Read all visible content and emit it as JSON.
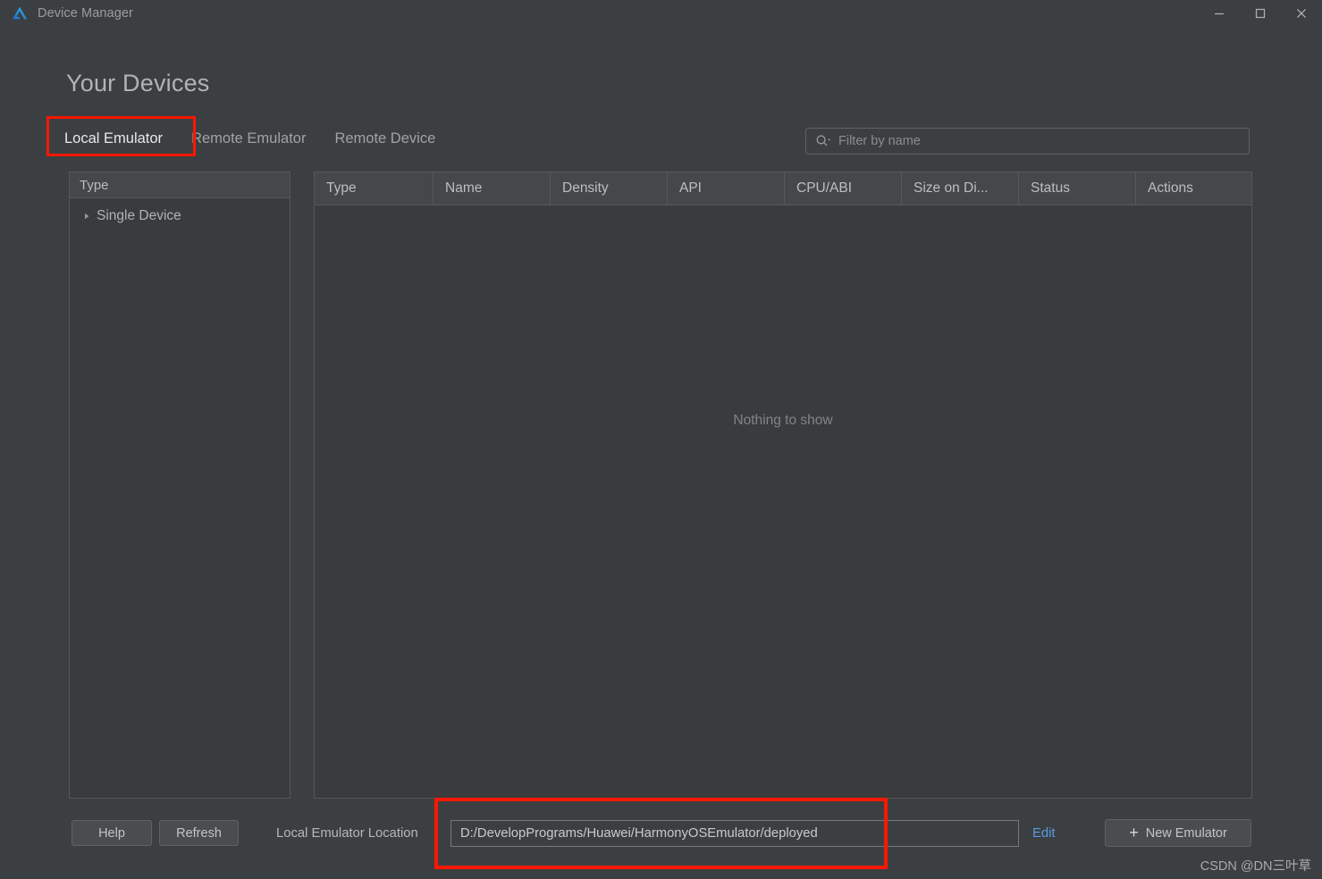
{
  "window": {
    "title": "Device Manager",
    "app_icon": "deveco-triangle-icon",
    "controls": {
      "minimize": "minimize-icon",
      "maximize": "maximize-icon",
      "close": "close-icon"
    }
  },
  "page": {
    "title": "Your Devices"
  },
  "tabs": [
    {
      "label": "Local Emulator",
      "active": true
    },
    {
      "label": "Remote Emulator",
      "active": false
    },
    {
      "label": "Remote Device",
      "active": false
    }
  ],
  "search": {
    "icon": "search-icon",
    "placeholder": "Filter by name",
    "value": ""
  },
  "type_panel": {
    "header": "Type",
    "items": [
      {
        "label": "Single Device",
        "expanded": false
      }
    ]
  },
  "device_table": {
    "columns": [
      "Type",
      "Name",
      "Density",
      "API",
      "CPU/ABI",
      "Size on Di...",
      "Status",
      "Actions"
    ],
    "rows": [],
    "empty_message": "Nothing to show"
  },
  "bottom_bar": {
    "help_label": "Help",
    "refresh_label": "Refresh",
    "location_label": "Local Emulator Location",
    "location_value": "D:/DevelopPrograms/Huawei/HarmonyOSEmulator/deployed",
    "edit_label": "Edit",
    "new_emulator_label": "New Emulator",
    "new_emulator_icon": "plus-icon"
  },
  "watermark": "CSDN @DN三叶草",
  "colors": {
    "background": "#3c3f41",
    "panel_background": "#393b3d",
    "header_background": "#45484a",
    "border": "#55585a",
    "text": "#b3b3b3",
    "muted_text": "#818487",
    "link": "#5a9ae8",
    "annotation": "#fb1703"
  }
}
